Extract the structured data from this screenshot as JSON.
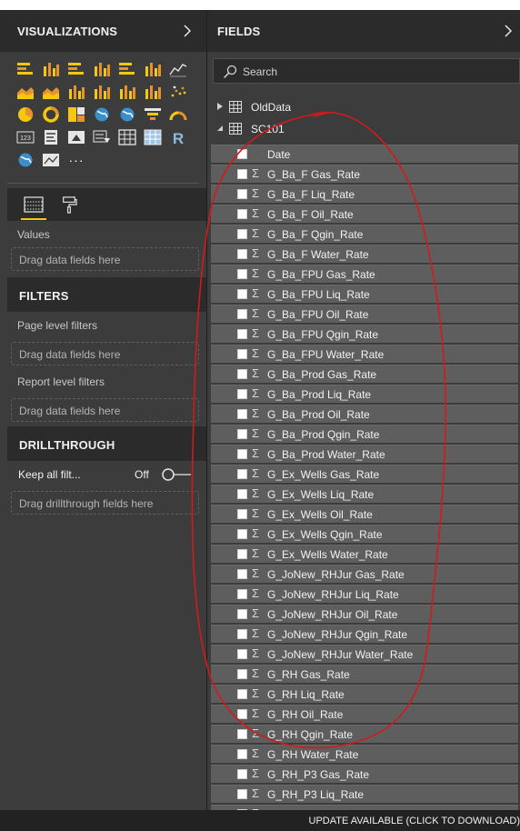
{
  "visualizations": {
    "title": "VISUALIZATIONS",
    "icons": [
      [
        "stacked-bar-chart-icon",
        "stacked-column-chart-icon",
        "clustered-bar-chart-icon",
        "clustered-column-chart-icon",
        "100-stacked-bar-chart-icon",
        "100-stacked-column-chart-icon",
        "line-chart-icon"
      ],
      [
        "area-chart-icon",
        "stacked-area-chart-icon",
        "line-clustered-column-icon",
        "line-stacked-column-icon",
        "ribbon-chart-icon",
        "waterfall-chart-icon",
        "scatter-chart-icon"
      ],
      [
        "pie-chart-icon",
        "donut-chart-icon",
        "treemap-icon",
        "map-icon",
        "filled-map-icon",
        "funnel-chart-icon",
        "gauge-icon"
      ],
      [
        "card-icon",
        "multi-row-card-icon",
        "kpi-icon",
        "slicer-icon",
        "table-visual-icon",
        "matrix-icon",
        "r-script-visual-icon"
      ],
      [
        "globe-map-icon",
        "image-visual-icon",
        "more-visuals-icon"
      ]
    ],
    "tabs": [
      "fields-tab-icon",
      "format-paintroller-icon"
    ],
    "values_label": "Values",
    "drop_placeholder": "Drag data fields here"
  },
  "filters": {
    "title": "FILTERS",
    "page_level": "Page level filters",
    "page_drop": "Drag data fields here",
    "report_level": "Report level filters",
    "report_drop": "Drag data fields here"
  },
  "drillthrough": {
    "title": "DRILLTHROUGH",
    "keep_all_label": "Keep all filt...",
    "toggle_state": "Off",
    "drop_placeholder": "Drag drillthrough fields here"
  },
  "fields": {
    "title": "FIELDS",
    "search_placeholder": "Search",
    "tables": [
      {
        "name": "OldData",
        "expanded": false
      },
      {
        "name": "SC101",
        "expanded": true
      }
    ],
    "sc101_fields": [
      {
        "name": "Date",
        "sigma": false
      },
      {
        "name": "G_Ba_F Gas_Rate",
        "sigma": true
      },
      {
        "name": "G_Ba_F Liq_Rate",
        "sigma": true
      },
      {
        "name": "G_Ba_F Oil_Rate",
        "sigma": true
      },
      {
        "name": "G_Ba_F Qgin_Rate",
        "sigma": true
      },
      {
        "name": "G_Ba_F Water_Rate",
        "sigma": true
      },
      {
        "name": "G_Ba_FPU Gas_Rate",
        "sigma": true
      },
      {
        "name": "G_Ba_FPU Liq_Rate",
        "sigma": true
      },
      {
        "name": "G_Ba_FPU Oil_Rate",
        "sigma": true
      },
      {
        "name": "G_Ba_FPU Qgin_Rate",
        "sigma": true
      },
      {
        "name": "G_Ba_FPU Water_Rate",
        "sigma": true
      },
      {
        "name": "G_Ba_Prod Gas_Rate",
        "sigma": true
      },
      {
        "name": "G_Ba_Prod Liq_Rate",
        "sigma": true
      },
      {
        "name": "G_Ba_Prod Oil_Rate",
        "sigma": true
      },
      {
        "name": "G_Ba_Prod Qgin_Rate",
        "sigma": true
      },
      {
        "name": "G_Ba_Prod Water_Rate",
        "sigma": true
      },
      {
        "name": "G_Ex_Wells Gas_Rate",
        "sigma": true
      },
      {
        "name": "G_Ex_Wells Liq_Rate",
        "sigma": true
      },
      {
        "name": "G_Ex_Wells Oil_Rate",
        "sigma": true
      },
      {
        "name": "G_Ex_Wells Qgin_Rate",
        "sigma": true
      },
      {
        "name": "G_Ex_Wells Water_Rate",
        "sigma": true
      },
      {
        "name": "G_JoNew_RHJur Gas_Rate",
        "sigma": true
      },
      {
        "name": "G_JoNew_RHJur Liq_Rate",
        "sigma": true
      },
      {
        "name": "G_JoNew_RHJur Oil_Rate",
        "sigma": true
      },
      {
        "name": "G_JoNew_RHJur Qgin_Rate",
        "sigma": true
      },
      {
        "name": "G_JoNew_RHJur Water_Rate",
        "sigma": true
      },
      {
        "name": "G_RH Gas_Rate",
        "sigma": true
      },
      {
        "name": "G_RH Liq_Rate",
        "sigma": true
      },
      {
        "name": "G_RH Oil_Rate",
        "sigma": true
      },
      {
        "name": "G_RH Qgin_Rate",
        "sigma": true
      },
      {
        "name": "G_RH Water_Rate",
        "sigma": true
      },
      {
        "name": "G_RH_P3 Gas_Rate",
        "sigma": true
      },
      {
        "name": "G_RH_P3 Liq_Rate",
        "sigma": true
      },
      {
        "name": "",
        "sigma": true
      }
    ]
  },
  "status_bar": {
    "update_text": "UPDATE AVAILABLE (CLICK TO DOWNLOAD)"
  },
  "colors": {
    "pane_bg": "#3c3c3c",
    "header_bg": "#2b2b2b",
    "field_row_bg": "#5e5e5e",
    "accent_yellow": "#f2c811",
    "annotation_red": "#d21a1a"
  }
}
